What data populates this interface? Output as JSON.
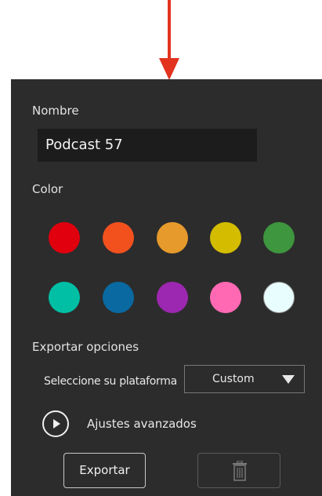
{
  "form": {
    "name_label": "Nombre",
    "name_value": "Podcast 57",
    "color_label": "Color",
    "export_options_label": "Exportar opciones",
    "platform_label": "Seleccione su plataforma",
    "platform_selected": "Custom",
    "advanced_label": "Ajustes avanzados",
    "export_button": "Exportar"
  },
  "colors": {
    "swatches": [
      "#e0000e",
      "#f2511e",
      "#e69a2b",
      "#d4bd00",
      "#3e963e",
      "#00bfa5",
      "#0969a0",
      "#9c27b0",
      "#ff69b4",
      "#e8fdfd"
    ],
    "annotation_arrow": "#e2331f",
    "panel_background": "#2c2c2c"
  },
  "icons": {
    "play": "play-circle-icon",
    "dropdown": "caret-down-icon",
    "delete": "trash-icon",
    "annotation": "arrow-down-icon"
  }
}
